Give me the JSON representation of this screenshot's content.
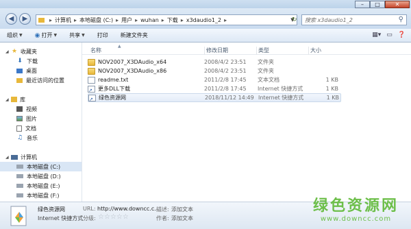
{
  "window": {
    "controls": [
      "–",
      "□",
      "✕"
    ]
  },
  "nav": {
    "breadcrumb": [
      "计算机",
      "本地磁盘 (C:)",
      "用户",
      "wuhan",
      "下载",
      "x3daudio1_2"
    ],
    "search_placeholder": "搜索 x3daudio1_2"
  },
  "toolbar": {
    "organize": "组织",
    "open": "打开",
    "share": "共享",
    "print": "打印",
    "new_folder": "新建文件夹"
  },
  "sidebar": {
    "favorites": {
      "label": "收藏夹",
      "items": [
        "下载",
        "桌面",
        "最近访问的位置"
      ]
    },
    "libraries": {
      "label": "库",
      "items": [
        "视频",
        "图片",
        "文档",
        "音乐"
      ]
    },
    "computer": {
      "label": "计算机",
      "items": [
        "本地磁盘 (C:)",
        "本地磁盘 (D:)",
        "本地磁盘 (E:)",
        "本地磁盘 (F:)"
      ]
    }
  },
  "columns": {
    "name": "名称",
    "date": "修改日期",
    "type": "类型",
    "size": "大小"
  },
  "files": [
    {
      "name": "NOV2007_X3DAudio_x64",
      "date": "2008/4/2 23:51",
      "type": "文件夹",
      "size": "",
      "kind": "folder"
    },
    {
      "name": "NOV2007_X3DAudio_x86",
      "date": "2008/4/2 23:51",
      "type": "文件夹",
      "size": "",
      "kind": "folder"
    },
    {
      "name": "readme.txt",
      "date": "2011/2/8 17:45",
      "type": "文本文档",
      "size": "1 KB",
      "kind": "txt"
    },
    {
      "name": "更多DLL下载",
      "date": "2011/2/8 17:45",
      "type": "Internet 快捷方式",
      "size": "1 KB",
      "kind": "link"
    },
    {
      "name": "绿色资源网",
      "date": "2018/11/12 14:49",
      "type": "Internet 快捷方式",
      "size": "1 KB",
      "kind": "link"
    }
  ],
  "details": {
    "name": "绿色资源网",
    "type": "Internet 快捷方式",
    "url_label": "URL:",
    "url_value": "http://www.downcc.c...",
    "rating_label": "分级:",
    "desc_label": "描述:",
    "desc_value": "添加文本",
    "author_label": "作者:",
    "author_value": "添加文本"
  },
  "watermark": {
    "main": "绿色资源网",
    "sub": "www.downcc.com"
  },
  "colors": {
    "accent": "#6dbf4a",
    "selection": "#d9e6f5"
  }
}
